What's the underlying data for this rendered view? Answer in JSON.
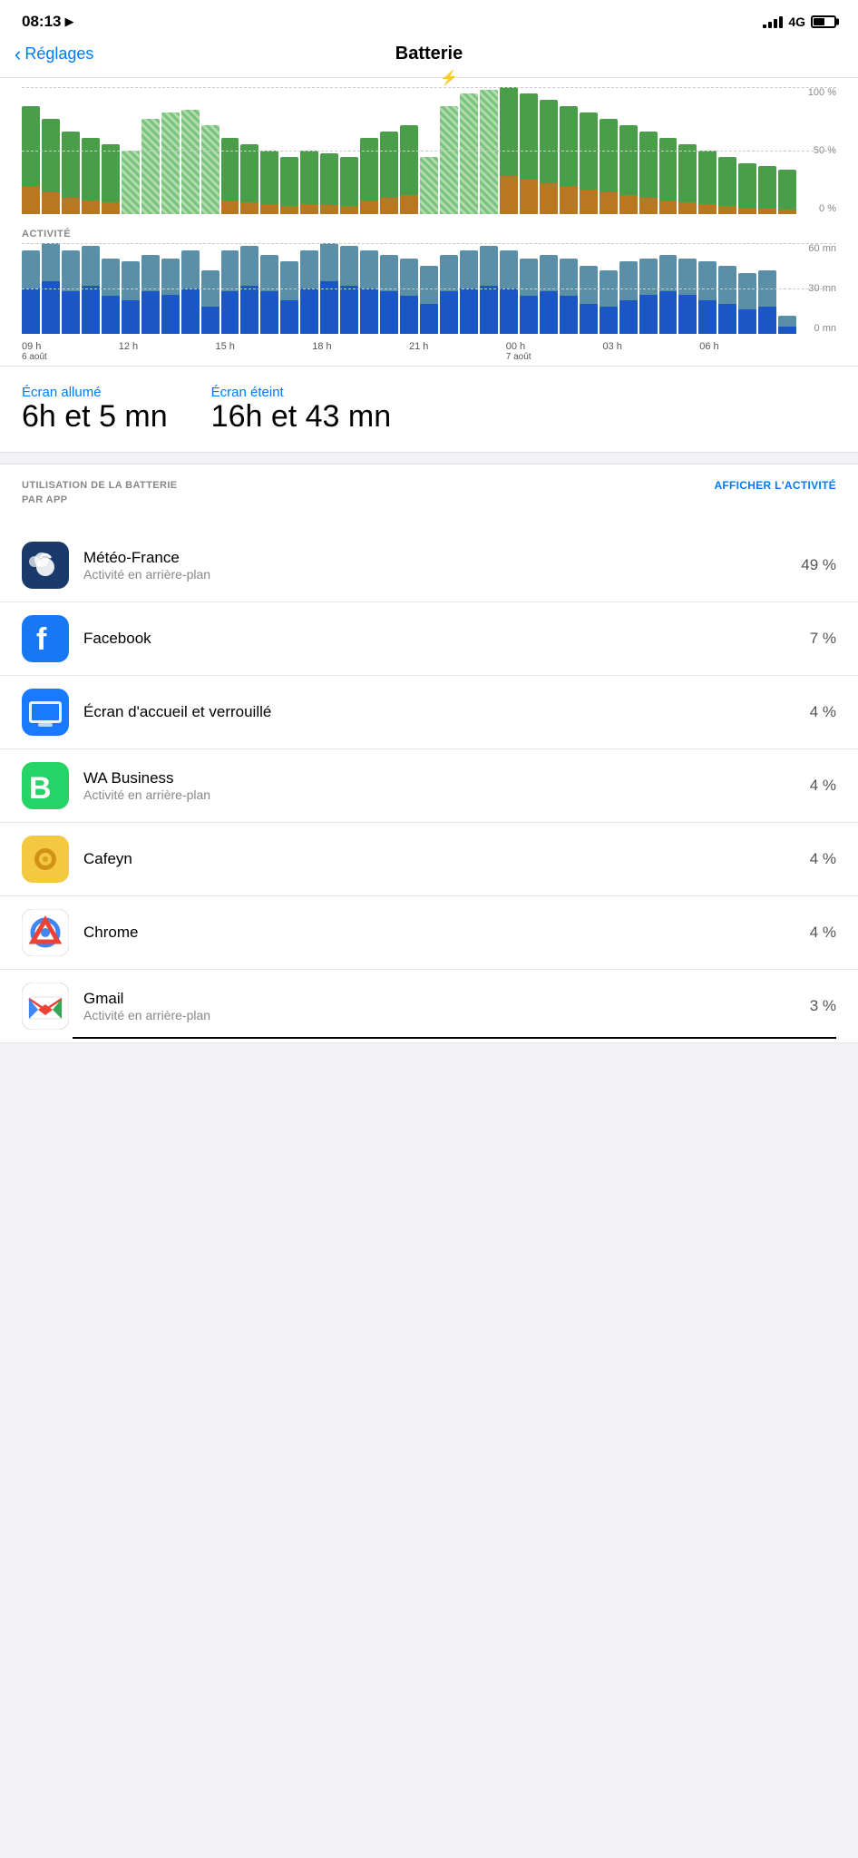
{
  "statusBar": {
    "time": "08:13",
    "locationIcon": "▶",
    "networkType": "4G",
    "batteryLevel": 55
  },
  "nav": {
    "backLabel": "Réglages",
    "title": "Batterie"
  },
  "batteryChart": {
    "yLabels": [
      "100 %",
      "50 %",
      "0 %"
    ],
    "data": [
      85,
      75,
      65,
      60,
      55,
      50,
      75,
      80,
      82,
      70,
      60,
      55,
      50,
      45,
      50,
      48,
      45,
      60,
      65,
      70,
      45,
      85,
      95,
      98,
      100,
      95,
      90,
      85,
      80,
      75,
      70,
      65,
      60,
      55,
      50,
      45,
      40,
      38,
      35
    ]
  },
  "activityChart": {
    "label": "ACTIVITÉ",
    "yLabels": [
      "60 mn",
      "30 mn",
      "0 mn"
    ],
    "outerData": [
      55,
      60,
      55,
      58,
      50,
      48,
      52,
      50,
      55,
      42,
      55,
      58,
      52,
      48,
      55,
      60,
      58,
      55,
      52,
      50,
      45,
      52,
      55,
      58,
      55,
      50,
      52,
      50,
      45,
      42,
      48,
      50,
      52,
      50,
      48,
      45,
      40,
      42,
      12
    ],
    "innerData": [
      30,
      35,
      28,
      32,
      25,
      22,
      28,
      26,
      30,
      18,
      28,
      32,
      28,
      22,
      30,
      35,
      32,
      30,
      28,
      25,
      20,
      28,
      30,
      32,
      30,
      25,
      28,
      25,
      20,
      18,
      22,
      26,
      28,
      26,
      22,
      20,
      16,
      18,
      5
    ]
  },
  "timeAxis": {
    "labels": [
      "09 h",
      "12 h",
      "15 h",
      "18 h",
      "21 h",
      "00 h",
      "03 h",
      "06 h"
    ],
    "dates": [
      "6 août",
      "",
      "",
      "",
      "",
      "7 août",
      "",
      ""
    ]
  },
  "screenOn": {
    "label": "Écran allumé",
    "value": "6h et 5 mn"
  },
  "screenOff": {
    "label": "Écran éteint",
    "value": "16h et 43 mn"
  },
  "usageSection": {
    "title": "UTILISATION DE LA BATTERIE\nPAR APP",
    "action": "AFFICHER L'ACTIVITÉ"
  },
  "apps": [
    {
      "name": "Météo-France",
      "subtitle": "Activité en arrière-plan",
      "percentage": "49 %",
      "iconType": "meteo"
    },
    {
      "name": "Facebook",
      "subtitle": "",
      "percentage": "7 %",
      "iconType": "facebook"
    },
    {
      "name": "Écran d'accueil et verrouillé",
      "subtitle": "",
      "percentage": "4 %",
      "iconType": "ecran"
    },
    {
      "name": "WA Business",
      "subtitle": "Activité en arrière-plan",
      "percentage": "4 %",
      "iconType": "wa"
    },
    {
      "name": "Cafeyn",
      "subtitle": "",
      "percentage": "4 %",
      "iconType": "cafeyn"
    },
    {
      "name": "Chrome",
      "subtitle": "",
      "percentage": "4 %",
      "iconType": "chrome"
    },
    {
      "name": "Gmail",
      "subtitle": "Activité en arrière-plan",
      "percentage": "3 %",
      "iconType": "gmail"
    }
  ]
}
